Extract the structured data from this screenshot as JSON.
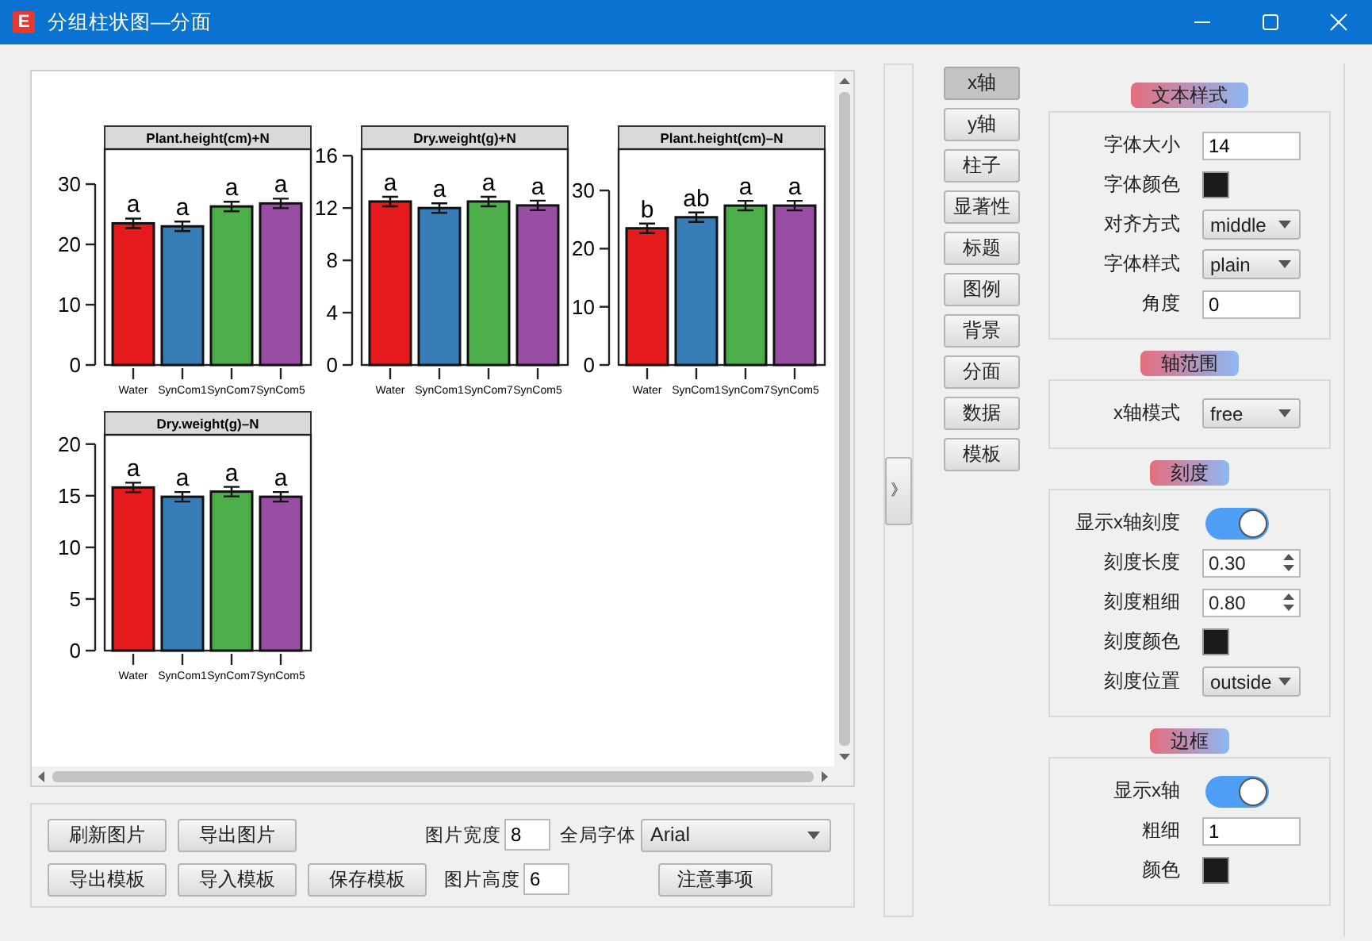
{
  "window": {
    "title": "分组柱状图—分面",
    "icon_text": "E"
  },
  "plot": {
    "panels": [
      {
        "chart_data": {
          "type": "bar",
          "title": "Plant.height(cm)+N",
          "categories": [
            "Water",
            "SynCom1",
            "SynCom7",
            "SynCom5"
          ],
          "values": [
            23.5,
            23.0,
            26.3,
            26.8
          ],
          "colors": [
            "#e41a1c",
            "#377eb8",
            "#4daf4a",
            "#984ea3"
          ],
          "annotations": [
            "a",
            "a",
            "a",
            "a"
          ],
          "ylim": [
            0,
            35.8
          ],
          "yticks": [
            0,
            10,
            20,
            30
          ]
        }
      },
      {
        "chart_data": {
          "type": "bar",
          "title": "Dry.weight(g)+N",
          "categories": [
            "Water",
            "SynCom1",
            "SynCom7",
            "SynCom5"
          ],
          "values": [
            12.5,
            12.0,
            12.5,
            12.2
          ],
          "colors": [
            "#e41a1c",
            "#377eb8",
            "#4daf4a",
            "#984ea3"
          ],
          "annotations": [
            "a",
            "a",
            "a",
            "a"
          ],
          "ylim": [
            0,
            16.5
          ],
          "yticks": [
            0,
            4,
            8,
            12,
            16
          ]
        }
      },
      {
        "chart_data": {
          "type": "bar",
          "title": "Plant.height(cm)–N",
          "categories": [
            "Water",
            "SynCom1",
            "SynCom7",
            "SynCom5"
          ],
          "values": [
            23.5,
            25.4,
            27.4,
            27.4
          ],
          "colors": [
            "#e41a1c",
            "#377eb8",
            "#4daf4a",
            "#984ea3"
          ],
          "annotations": [
            "b",
            "ab",
            "a",
            "a"
          ],
          "ylim": [
            0,
            37.1
          ],
          "yticks": [
            0,
            10,
            20,
            30
          ]
        }
      },
      {
        "chart_data": {
          "type": "bar",
          "title": "Dry.weight(g)–N",
          "categories": [
            "Water",
            "SynCom1",
            "SynCom7",
            "SynCom5"
          ],
          "values": [
            15.8,
            14.9,
            15.4,
            14.9
          ],
          "colors": [
            "#e41a1c",
            "#377eb8",
            "#4daf4a",
            "#984ea3"
          ],
          "annotations": [
            "a",
            "a",
            "a",
            "a"
          ],
          "ylim": [
            0,
            20.9
          ],
          "yticks": [
            0,
            5,
            10,
            15,
            20
          ]
        }
      }
    ]
  },
  "bottom_bar": {
    "buttons_row_1": [
      "刷新图片",
      "导出图片"
    ],
    "buttons_row_2": [
      "导出模板",
      "导入模板",
      "保存模板"
    ],
    "width_field": {
      "label": "图片宽度",
      "value": "8"
    },
    "height_field": {
      "label": "图片高度",
      "value": "6"
    },
    "font_select": {
      "label": "全局字体",
      "value": "Arial"
    },
    "notes_button": "注意事项"
  },
  "collapse_button": "》",
  "tabs": [
    {
      "label": "x轴",
      "selected": true
    },
    {
      "label": "y轴",
      "selected": false
    },
    {
      "label": "柱子",
      "selected": false
    },
    {
      "label": "显著性",
      "selected": false
    },
    {
      "label": "标题",
      "selected": false
    },
    {
      "label": "图例",
      "selected": false
    },
    {
      "label": "背景",
      "selected": false
    },
    {
      "label": "分面",
      "selected": false
    },
    {
      "label": "数据",
      "selected": false
    },
    {
      "label": "模板",
      "selected": false
    }
  ],
  "sections": [
    {
      "title": "文本样式",
      "rows": [
        {
          "kind": "text",
          "label": "字体大小",
          "value": "14"
        },
        {
          "kind": "color",
          "label": "字体颜色",
          "color": "#1a1a1a"
        },
        {
          "kind": "select",
          "label": "对齐方式",
          "value": "middle"
        },
        {
          "kind": "select",
          "label": "字体样式",
          "value": "plain"
        },
        {
          "kind": "text",
          "label": "角度",
          "value": "0"
        }
      ]
    },
    {
      "title": "轴范围",
      "rows": [
        {
          "kind": "select",
          "label": "x轴模式",
          "value": "free"
        }
      ]
    },
    {
      "title": "刻度",
      "rows": [
        {
          "kind": "toggle",
          "label": "显示x轴刻度",
          "on": true
        },
        {
          "kind": "spin",
          "label": "刻度长度",
          "value": "0.30"
        },
        {
          "kind": "spin",
          "label": "刻度粗细",
          "value": "0.80"
        },
        {
          "kind": "color",
          "label": "刻度颜色",
          "color": "#1a1a1a"
        },
        {
          "kind": "select",
          "label": "刻度位置",
          "value": "outside"
        }
      ]
    },
    {
      "title": "边框",
      "rows": [
        {
          "kind": "toggle",
          "label": "显示x轴",
          "on": true
        },
        {
          "kind": "text",
          "label": "粗细",
          "value": "1"
        },
        {
          "kind": "color",
          "label": "颜色",
          "color": "#1a1a1a"
        }
      ]
    }
  ]
}
